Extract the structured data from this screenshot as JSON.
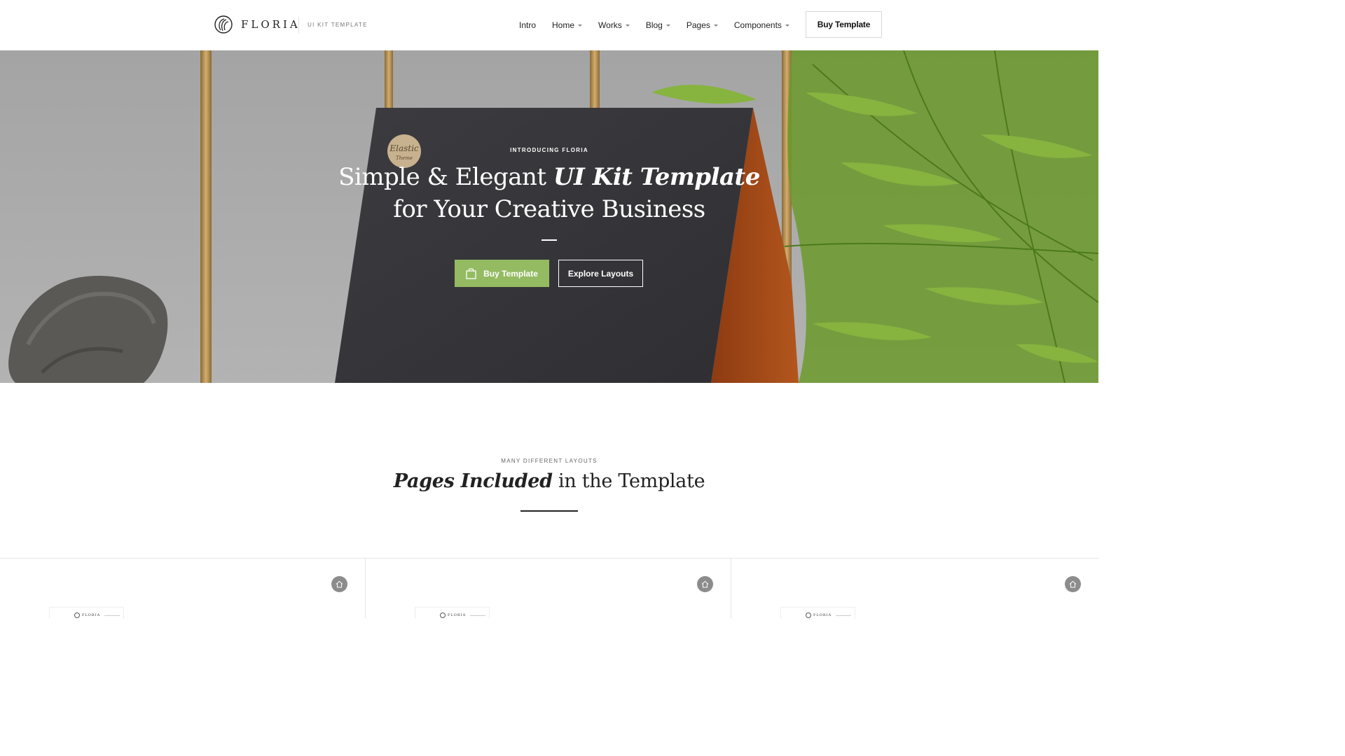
{
  "header": {
    "brand": "FLORIA",
    "tagline": "UI KIT TEMPLATE",
    "nav": [
      {
        "label": "Intro",
        "dropdown": false
      },
      {
        "label": "Home",
        "dropdown": true
      },
      {
        "label": "Works",
        "dropdown": true
      },
      {
        "label": "Blog",
        "dropdown": true
      },
      {
        "label": "Pages",
        "dropdown": true
      },
      {
        "label": "Components",
        "dropdown": true
      }
    ],
    "buy_label": "Buy Template"
  },
  "hero": {
    "eyebrow": "INTRODUCING FLORIA",
    "title_part1": "Simple & Elegant ",
    "title_emphasis": "UI Kit Template",
    "title_line2": "for Your Creative Business",
    "buy_label": "Buy Template",
    "explore_label": "Explore Layouts",
    "badge_text_1": "Elastic",
    "badge_text_2": "Theme"
  },
  "section": {
    "eyebrow": "MANY DIFFERENT LAYOUTS",
    "title_emphasis": "Pages Included",
    "title_rest": " in the Template"
  },
  "cards": [
    {
      "brand": "FLORIA"
    },
    {
      "brand": "FLORIA"
    },
    {
      "brand": "FLORIA"
    }
  ],
  "colors": {
    "accent": "#94bb62",
    "hero_bg": "#a9a9a9",
    "text_dark": "#222222"
  }
}
